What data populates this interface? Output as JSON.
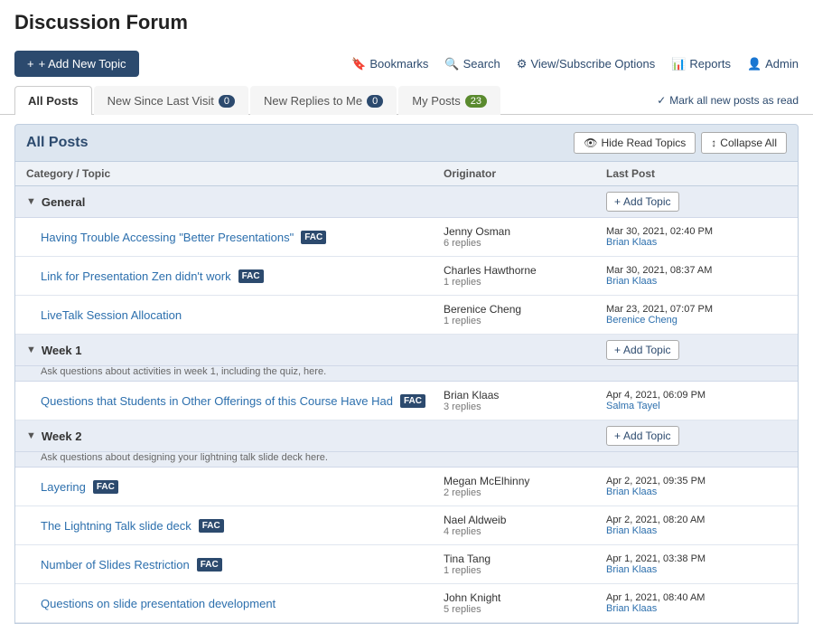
{
  "page": {
    "title": "Discussion Forum"
  },
  "toolbar": {
    "add_topic_label": "+ Add New Topic",
    "nav": {
      "bookmarks": "Bookmarks",
      "search": "Search",
      "view_subscribe": "View/Subscribe Options",
      "reports": "Reports",
      "admin": "Admin"
    }
  },
  "tabs": [
    {
      "id": "all-posts",
      "label": "All Posts",
      "badge": null,
      "active": true
    },
    {
      "id": "new-since",
      "label": "New Since Last Visit",
      "badge": "0",
      "active": false
    },
    {
      "id": "new-replies",
      "label": "New Replies to Me",
      "badge": "0",
      "active": false
    },
    {
      "id": "my-posts",
      "label": "My Posts",
      "badge": "23",
      "active": false
    }
  ],
  "mark_read": "Mark all new posts as read",
  "all_posts": {
    "title": "All Posts",
    "hide_read": "Hide Read Topics",
    "collapse_all": "Collapse All"
  },
  "table_headers": {
    "topic": "Category / Topic",
    "originator": "Originator",
    "last_post": "Last Post"
  },
  "categories": [
    {
      "name": "General",
      "description": "",
      "add_topic": "+ Add Topic",
      "topics": [
        {
          "title": "Having Trouble Accessing \"Better Presentations\"",
          "fac": true,
          "originator": "Jenny Osman",
          "replies": "6 replies",
          "last_post_date": "Mar 30, 2021, 02:40 PM",
          "last_post_author": "Brian Klaas"
        },
        {
          "title": "Link for Presentation Zen didn't work",
          "fac": true,
          "originator": "Charles Hawthorne",
          "replies": "1 replies",
          "last_post_date": "Mar 30, 2021, 08:37 AM",
          "last_post_author": "Brian Klaas"
        },
        {
          "title": "LiveTalk Session Allocation",
          "fac": false,
          "originator": "Berenice Cheng",
          "replies": "1 replies",
          "last_post_date": "Mar 23, 2021, 07:07 PM",
          "last_post_author": "Berenice Cheng"
        }
      ]
    },
    {
      "name": "Week 1",
      "description": "Ask questions about activities in week 1, including the quiz, here.",
      "add_topic": "+ Add Topic",
      "topics": [
        {
          "title": "Questions that Students in Other Offerings of this Course Have Had",
          "fac": true,
          "originator": "Brian Klaas",
          "replies": "3 replies",
          "last_post_date": "Apr 4, 2021, 06:09 PM",
          "last_post_author": "Salma Tayel"
        }
      ]
    },
    {
      "name": "Week 2",
      "description": "Ask questions about designing your lightning talk slide deck here.",
      "add_topic": "+ Add Topic",
      "topics": [
        {
          "title": "Layering",
          "fac": true,
          "originator": "Megan McElhinny",
          "replies": "2 replies",
          "last_post_date": "Apr 2, 2021, 09:35 PM",
          "last_post_author": "Brian Klaas"
        },
        {
          "title": "The Lightning Talk slide deck",
          "fac": true,
          "originator": "Nael Aldweib",
          "replies": "4 replies",
          "last_post_date": "Apr 2, 2021, 08:20 AM",
          "last_post_author": "Brian Klaas"
        },
        {
          "title": "Number of Slides Restriction",
          "fac": true,
          "originator": "Tina Tang",
          "replies": "1 replies",
          "last_post_date": "Apr 1, 2021, 03:38 PM",
          "last_post_author": "Brian Klaas"
        },
        {
          "title": "Questions on slide presentation development",
          "fac": false,
          "originator": "John Knight",
          "replies": "5 replies",
          "last_post_date": "Apr 1, 2021, 08:40 AM",
          "last_post_author": "Brian Klaas"
        }
      ]
    }
  ],
  "icons": {
    "bookmark": "🔖",
    "search": "🔍",
    "gear": "⚙",
    "chart": "📊",
    "admin": "👤",
    "checkmark": "✓",
    "eye_off": "👁",
    "expand": "↕",
    "fac": "FAC"
  }
}
